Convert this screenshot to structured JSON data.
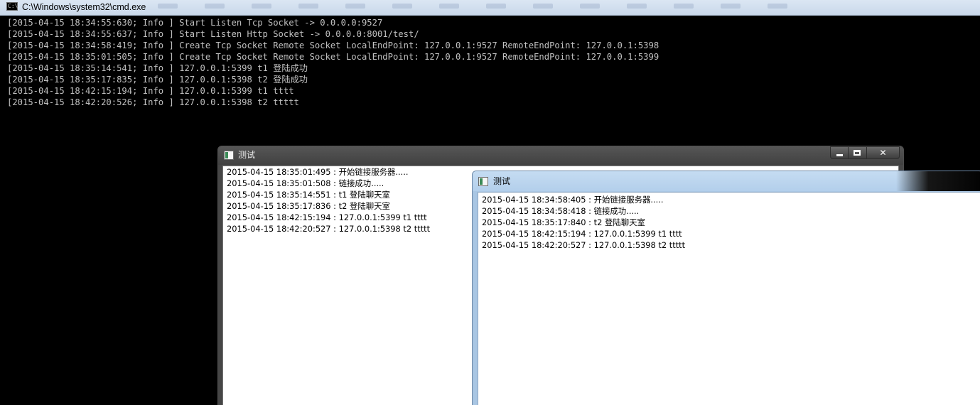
{
  "cmd": {
    "title": "C:\\Windows\\system32\\cmd.exe",
    "icon": "console-icon",
    "lines": [
      "[2015-04-15 18:34:55:630; Info ] Start Listen Tcp Socket -> 0.0.0.0:9527",
      "[2015-04-15 18:34:55:637; Info ] Start Listen Http Socket -> 0.0.0.0:8001/test/",
      "[2015-04-15 18:34:58:419; Info ] Create Tcp Socket Remote Socket LocalEndPoint: 127.0.0.1:9527 RemoteEndPoint: 127.0.0.1:5398",
      "[2015-04-15 18:35:01:505; Info ] Create Tcp Socket Remote Socket LocalEndPoint: 127.0.0.1:9527 RemoteEndPoint: 127.0.0.1:5399",
      "[2015-04-15 18:35:14:541; Info ] 127.0.0.1:5399 t1 登陆成功",
      "[2015-04-15 18:35:17:835; Info ] 127.0.0.1:5398 t2 登陆成功",
      "[2015-04-15 18:42:15:194; Info ] 127.0.0.1:5399 t1 tttt",
      "[2015-04-15 18:42:20:526; Info ] 127.0.0.1:5398 t2 ttttt"
    ]
  },
  "window1": {
    "title": "测试",
    "icon": "app-window-icon",
    "controls": {
      "minimize": "minimize-icon",
      "maximize": "maximize-icon",
      "close_label": "✕"
    },
    "lines": [
      "2015-04-15 18:35:01:495 : 开始链接服务器.....",
      "2015-04-15 18:35:01:508 : 链接成功.....",
      "2015-04-15 18:35:14:551 : t1 登陆聊天室",
      "2015-04-15 18:35:17:836 : t2 登陆聊天室",
      "2015-04-15 18:42:15:194 : 127.0.0.1:5399 t1 tttt",
      "2015-04-15 18:42:20:527 : 127.0.0.1:5398 t2 ttttt"
    ]
  },
  "window2": {
    "title": "测试",
    "icon": "app-window-icon",
    "lines": [
      "2015-04-15 18:34:58:405 : 开始链接服务器.....",
      "2015-04-15 18:34:58:418 : 链接成功.....",
      "2015-04-15 18:35:17:840 : t2 登陆聊天室",
      "2015-04-15 18:42:15:194 : 127.0.0.1:5399 t1 tttt",
      "2015-04-15 18:42:20:527 : 127.0.0.1:5398 t2 ttttt"
    ]
  }
}
